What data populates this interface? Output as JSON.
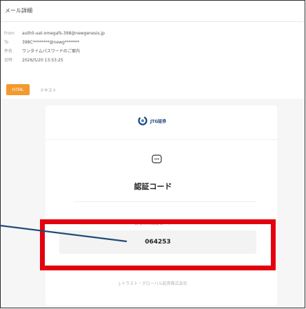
{
  "window": {
    "title": "メール詳細"
  },
  "meta": [
    {
      "key": "From",
      "value": "auth0-uat-omegafs-398@newgenesis.jp"
    },
    {
      "key": "To",
      "value": "398C********@newg*******"
    },
    {
      "key": "件名",
      "value": "ワンタイムパスワードのご案内"
    },
    {
      "key": "日時",
      "value": "2026/5/20 13:53:25"
    }
  ],
  "view_tabs": {
    "html": "HTML",
    "text": "テキスト"
  },
  "email": {
    "brand": "JTG証券",
    "title": "認証コード",
    "code_label": "あなたの認証コード",
    "code": "064253",
    "footer": "J-トラスト・グローバル証券株式会社"
  },
  "colors": {
    "accent": "#f29a2e",
    "highlight": "#e3000f",
    "pointer_line": "#1f4b7a"
  }
}
